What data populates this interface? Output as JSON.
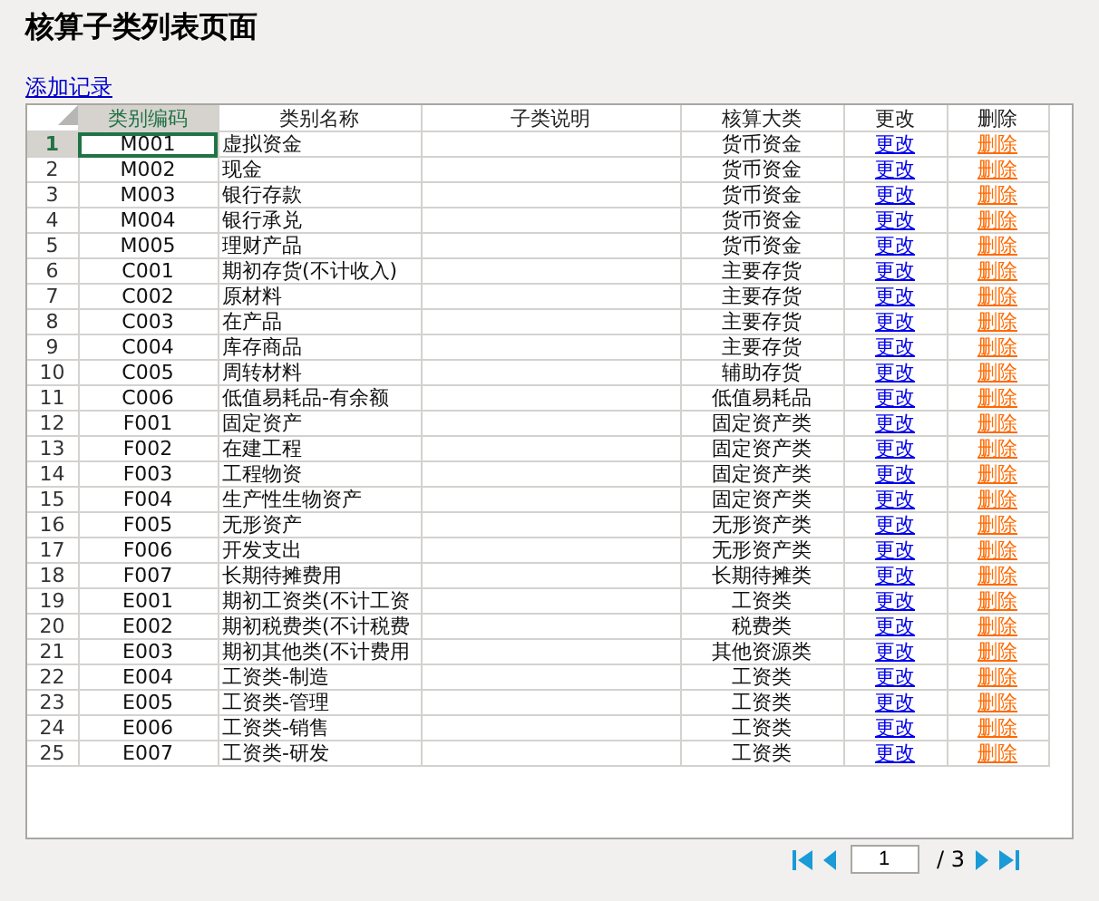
{
  "page_title": "核算子类列表页面",
  "add_link": "添加记录",
  "table": {
    "columns": [
      {
        "label": "类别编码",
        "selected": true
      },
      {
        "label": "类别名称",
        "selected": false
      },
      {
        "label": "子类说明",
        "selected": false
      },
      {
        "label": "核算大类",
        "selected": false
      },
      {
        "label": "更改",
        "selected": false
      },
      {
        "label": "删除",
        "selected": false
      }
    ],
    "rows": [
      {
        "num": "1",
        "code": "M001",
        "name": "虚拟资金",
        "category": "货币资金",
        "edit": "更改",
        "delete": "删除",
        "selected": true
      },
      {
        "num": "2",
        "code": "M002",
        "name": "现金",
        "category": "货币资金",
        "edit": "更改",
        "delete": "删除",
        "selected": false
      },
      {
        "num": "3",
        "code": "M003",
        "name": "银行存款",
        "category": "货币资金",
        "edit": "更改",
        "delete": "删除",
        "selected": false
      },
      {
        "num": "4",
        "code": "M004",
        "name": "银行承兑",
        "category": "货币资金",
        "edit": "更改",
        "delete": "删除",
        "selected": false
      },
      {
        "num": "5",
        "code": "M005",
        "name": "理财产品",
        "category": "货币资金",
        "edit": "更改",
        "delete": "删除",
        "selected": false
      },
      {
        "num": "6",
        "code": "C001",
        "name": "期初存货(不计收入)",
        "category": "主要存货",
        "edit": "更改",
        "delete": "删除",
        "selected": false
      },
      {
        "num": "7",
        "code": "C002",
        "name": "原材料",
        "category": "主要存货",
        "edit": "更改",
        "delete": "删除",
        "selected": false
      },
      {
        "num": "8",
        "code": "C003",
        "name": "在产品",
        "category": "主要存货",
        "edit": "更改",
        "delete": "删除",
        "selected": false
      },
      {
        "num": "9",
        "code": "C004",
        "name": "库存商品",
        "category": "主要存货",
        "edit": "更改",
        "delete": "删除",
        "selected": false
      },
      {
        "num": "10",
        "code": "C005",
        "name": "周转材料",
        "category": "辅助存货",
        "edit": "更改",
        "delete": "删除",
        "selected": false
      },
      {
        "num": "11",
        "code": "C006",
        "name": "低值易耗品-有余额",
        "category": "低值易耗品",
        "edit": "更改",
        "delete": "删除",
        "selected": false
      },
      {
        "num": "12",
        "code": "F001",
        "name": "固定资产",
        "category": "固定资产类",
        "edit": "更改",
        "delete": "删除",
        "selected": false
      },
      {
        "num": "13",
        "code": "F002",
        "name": "在建工程",
        "category": "固定资产类",
        "edit": "更改",
        "delete": "删除",
        "selected": false
      },
      {
        "num": "14",
        "code": "F003",
        "name": "工程物资",
        "category": "固定资产类",
        "edit": "更改",
        "delete": "删除",
        "selected": false
      },
      {
        "num": "15",
        "code": "F004",
        "name": "生产性生物资产",
        "category": "固定资产类",
        "edit": "更改",
        "delete": "删除",
        "selected": false
      },
      {
        "num": "16",
        "code": "F005",
        "name": "无形资产",
        "category": "无形资产类",
        "edit": "更改",
        "delete": "删除",
        "selected": false
      },
      {
        "num": "17",
        "code": "F006",
        "name": "开发支出",
        "category": "无形资产类",
        "edit": "更改",
        "delete": "删除",
        "selected": false
      },
      {
        "num": "18",
        "code": "F007",
        "name": "长期待摊费用",
        "category": "长期待摊类",
        "edit": "更改",
        "delete": "删除",
        "selected": false
      },
      {
        "num": "19",
        "code": "E001",
        "name": "期初工资类(不计工资",
        "category": "工资类",
        "edit": "更改",
        "delete": "删除",
        "selected": false
      },
      {
        "num": "20",
        "code": "E002",
        "name": "期初税费类(不计税费",
        "category": "税费类",
        "edit": "更改",
        "delete": "删除",
        "selected": false
      },
      {
        "num": "21",
        "code": "E003",
        "name": "期初其他类(不计费用",
        "category": "其他资源类",
        "edit": "更改",
        "delete": "删除",
        "selected": false
      },
      {
        "num": "22",
        "code": "E004",
        "name": "工资类-制造",
        "category": "工资类",
        "edit": "更改",
        "delete": "删除",
        "selected": false
      },
      {
        "num": "23",
        "code": "E005",
        "name": "工资类-管理",
        "category": "工资类",
        "edit": "更改",
        "delete": "删除",
        "selected": false
      },
      {
        "num": "24",
        "code": "E006",
        "name": "工资类-销售",
        "category": "工资类",
        "edit": "更改",
        "delete": "删除",
        "selected": false
      },
      {
        "num": "25",
        "code": "E007",
        "name": "工资类-研发",
        "category": "工资类",
        "edit": "更改",
        "delete": "删除",
        "selected": false
      }
    ]
  },
  "pagination": {
    "page": "1",
    "total": "/ 3"
  }
}
